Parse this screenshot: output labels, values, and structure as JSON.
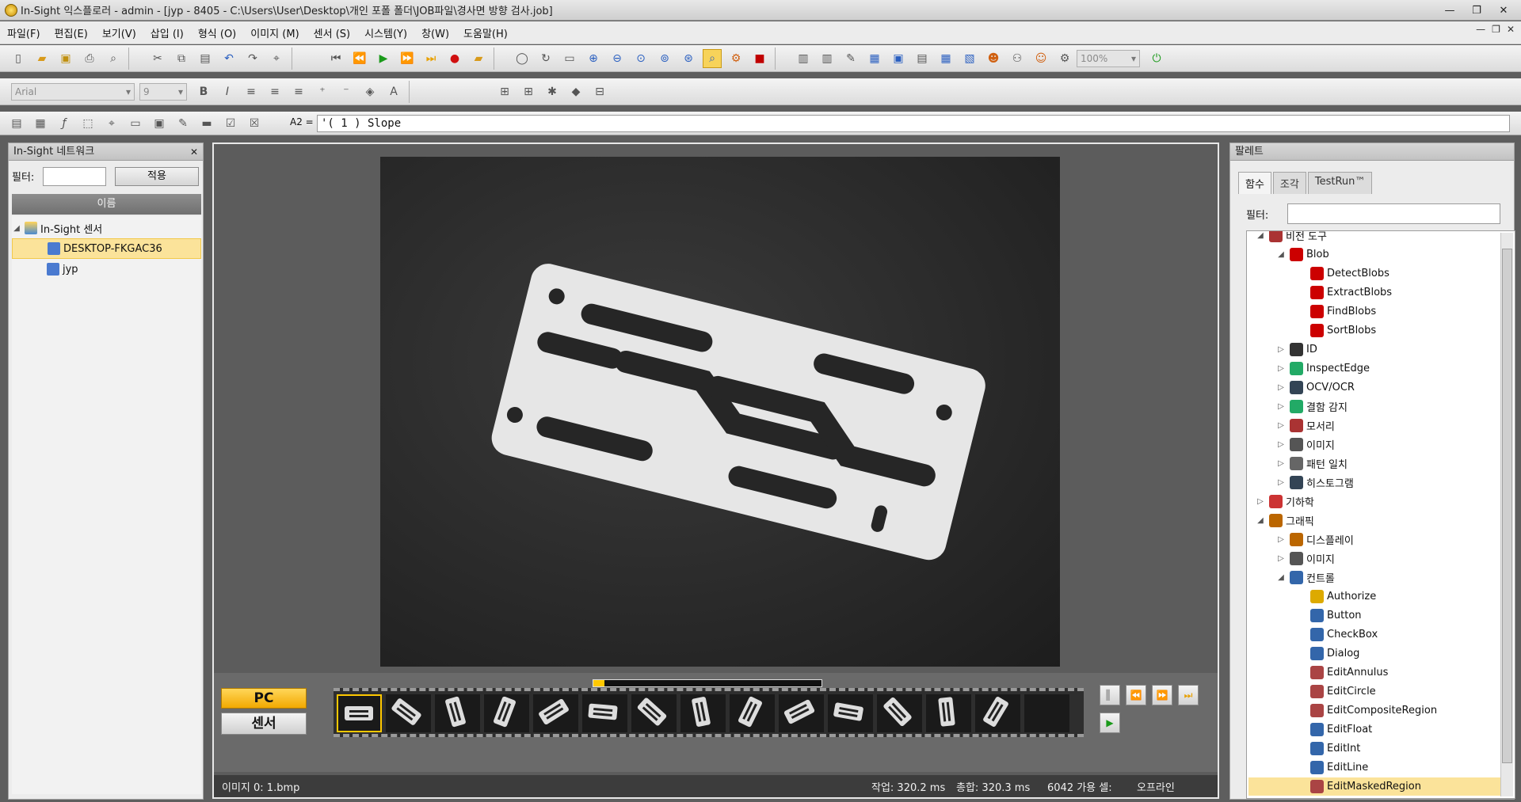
{
  "window": {
    "title": "In-Sight 익스플로러 - admin - [jyp - 8405 - C:\\Users\\User\\Desktop\\개인 포폴 폴더\\JOB파일\\경사면 방향 검사.job]"
  },
  "menu": [
    "파일(F)",
    "편집(E)",
    "보기(V)",
    "삽입 (I)",
    "형식 (O)",
    "이미지 (M)",
    "센서 (S)",
    "시스템(Y)",
    "창(W)",
    "도움말(H)"
  ],
  "toolbar": {
    "font": "Arial",
    "size": "9",
    "zoom": "100%"
  },
  "formula": {
    "cell": "A2 =",
    "text": "'( 1 )  Slope"
  },
  "network": {
    "title": "In-Sight 네트워크",
    "filter_label": "필터:",
    "apply": "적용",
    "column": "이름",
    "root": "In-Sight 센서",
    "items": [
      "DESKTOP-FKGAC36",
      "jyp"
    ]
  },
  "strip": {
    "pc": "PC",
    "sensor": "센서",
    "progress": 0.05,
    "thumb_count": 14
  },
  "status": {
    "image": "이미지 0: 1.bmp",
    "job_time": "작업: 320.2 ms",
    "total_time": "총합: 320.3 ms",
    "cells": "6042 가용 셀:",
    "mode": "오프라인"
  },
  "palette": {
    "title": "팔레트",
    "tabs": [
      "함수",
      "조각",
      "TestRun™"
    ],
    "filter_label": "필터:",
    "items": [
      {
        "label": "비전 도구",
        "level": 0,
        "open": true,
        "icon": "tools-icon"
      },
      {
        "label": "Blob",
        "level": 1,
        "open": true,
        "icon": "blob-icon"
      },
      {
        "label": "DetectBlobs",
        "level": 2,
        "icon": "blob-icon"
      },
      {
        "label": "ExtractBlobs",
        "level": 2,
        "icon": "blob-icon"
      },
      {
        "label": "FindBlobs",
        "level": 2,
        "icon": "blob-icon"
      },
      {
        "label": "SortBlobs",
        "level": 2,
        "icon": "blob-icon"
      },
      {
        "label": "ID",
        "level": 1,
        "open": false,
        "icon": "barcode-icon"
      },
      {
        "label": "InspectEdge",
        "level": 1,
        "open": false,
        "icon": "magnifier-icon"
      },
      {
        "label": "OCV/OCR",
        "level": 1,
        "open": false,
        "icon": "ocr-icon"
      },
      {
        "label": "결함 감지",
        "level": 1,
        "open": false,
        "icon": "defect-icon"
      },
      {
        "label": "모서리",
        "level": 1,
        "open": false,
        "icon": "edge-icon"
      },
      {
        "label": "이미지",
        "level": 1,
        "open": false,
        "icon": "image-icon"
      },
      {
        "label": "패턴 일치",
        "level": 1,
        "open": false,
        "icon": "pattern-icon"
      },
      {
        "label": "히스토그램",
        "level": 1,
        "open": false,
        "icon": "histogram-icon"
      },
      {
        "label": "기하학",
        "level": 0,
        "open": false,
        "icon": "geometry-icon"
      },
      {
        "label": "그래픽",
        "level": 0,
        "open": true,
        "icon": "graphics-icon"
      },
      {
        "label": "디스플레이",
        "level": 1,
        "open": false,
        "icon": "display-icon"
      },
      {
        "label": "이미지",
        "level": 1,
        "open": false,
        "icon": "image-icon"
      },
      {
        "label": "컨트롤",
        "level": 1,
        "open": true,
        "icon": "control-icon"
      },
      {
        "label": "Authorize",
        "level": 2,
        "icon": "key-icon"
      },
      {
        "label": "Button",
        "level": 2,
        "icon": "button-icon"
      },
      {
        "label": "CheckBox",
        "level": 2,
        "icon": "checkbox-icon"
      },
      {
        "label": "Dialog",
        "level": 2,
        "icon": "dialog-icon"
      },
      {
        "label": "EditAnnulus",
        "level": 2,
        "icon": "annulus-icon"
      },
      {
        "label": "EditCircle",
        "level": 2,
        "icon": "circle-icon"
      },
      {
        "label": "EditCompositeRegion",
        "level": 2,
        "icon": "region-icon"
      },
      {
        "label": "EditFloat",
        "level": 2,
        "icon": "float-icon"
      },
      {
        "label": "EditInt",
        "level": 2,
        "icon": "int-icon"
      },
      {
        "label": "EditLine",
        "level": 2,
        "icon": "line-icon"
      },
      {
        "label": "EditMaskedRegion",
        "level": 2,
        "icon": "mask-icon",
        "selected": true
      }
    ]
  },
  "colors": {
    "accent": "#ffc800",
    "selection": "#fbe39a",
    "blob": "#d11"
  }
}
